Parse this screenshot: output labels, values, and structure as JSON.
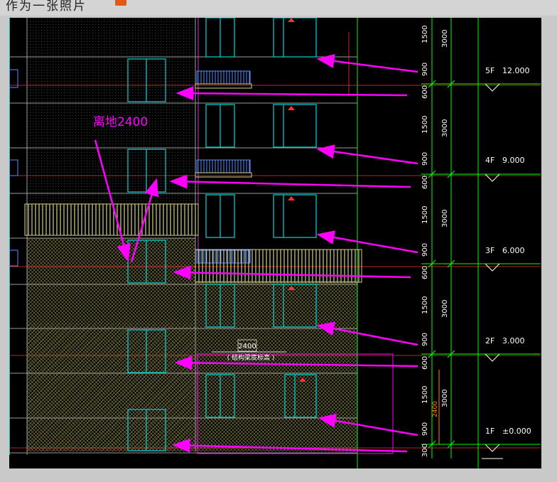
{
  "window": {
    "title": "作为一张照片",
    "badge_icon": "search-icon"
  },
  "drawing": {
    "annotation": "离地2400",
    "bottom_note_value": "2400",
    "bottom_note_text": "( 结构梁底标高 )",
    "vertical_dim_small": "2400",
    "vertical_dim_small_total": "3000"
  },
  "floor_levels": [
    {
      "label": "5F",
      "elevation": "12.000"
    },
    {
      "label": "4F",
      "elevation": "9.000"
    },
    {
      "label": "3F",
      "elevation": "6.000"
    },
    {
      "label": "2F",
      "elevation": "3.000"
    },
    {
      "label": "1F",
      "elevation": "±0.000"
    }
  ],
  "dimensions_inner": [
    "1500",
    "900",
    "600",
    "1500",
    "900",
    "600",
    "1500",
    "900",
    "600",
    "1500",
    "900",
    "600",
    "1500",
    "900",
    "300"
  ],
  "dimensions_outer": [
    "3000",
    "3000",
    "3000",
    "3000",
    "3000"
  ],
  "colors": {
    "background": "#000000",
    "grid_line": "#00ff00",
    "annotation": "#ff00ff",
    "window_frame": "#00c8c8",
    "wall_hatch": "#b8b46a",
    "balcony": "#5a8cff",
    "level_line": "#ff3030"
  }
}
